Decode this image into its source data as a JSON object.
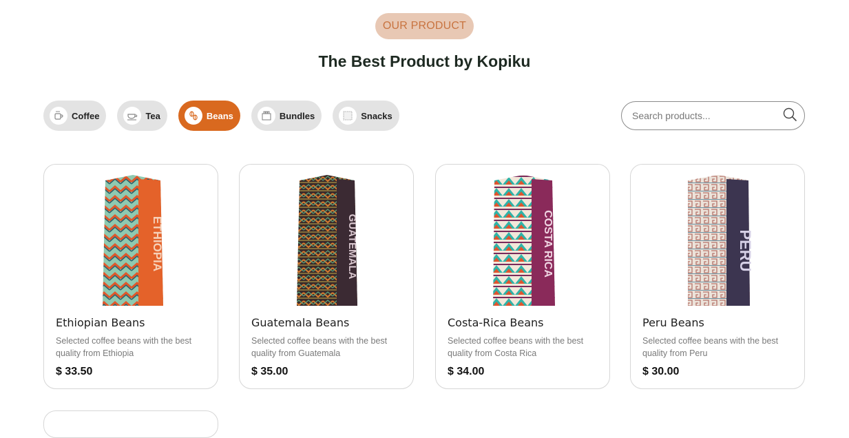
{
  "section": {
    "badge": "OUR PRODUCT",
    "title": "The Best Product by Kopiku"
  },
  "filters": [
    {
      "label": "Coffee",
      "icon": "coffee-cup-icon",
      "active": false
    },
    {
      "label": "Tea",
      "icon": "teacup-icon",
      "active": false
    },
    {
      "label": "Beans",
      "icon": "beans-icon",
      "active": true
    },
    {
      "label": "Bundles",
      "icon": "bundle-box-icon",
      "active": false
    },
    {
      "label": "Snacks",
      "icon": "snack-icon",
      "active": false
    }
  ],
  "search": {
    "placeholder": "Search products...",
    "value": "",
    "icon": "search-icon"
  },
  "products": [
    {
      "name": "Ethiopian Beans",
      "description": "Selected coffee beans with the best quality from Ethiopia",
      "price": "$ 33.50",
      "bag_text": "ETHIOPIA",
      "colors": {
        "pattern": "#3f9c8a",
        "accent": "#e4622a"
      }
    },
    {
      "name": "Guatemala Beans",
      "description": "Selected coffee beans with the best quality from Guatemala",
      "price": "$ 35.00",
      "bag_text": "GUATEMALA",
      "colors": {
        "pattern": "#6a3a2a",
        "accent": "#3b2a33"
      }
    },
    {
      "name": "Costa-Rica Beans",
      "description": "Selected coffee beans with the best quality from Costa Rica",
      "price": "$ 34.00",
      "bag_text": "COSTA RICA",
      "colors": {
        "pattern": "#2fb3a8",
        "accent": "#8a2a5a"
      }
    },
    {
      "name": "Peru Beans",
      "description": "Selected coffee beans with the best quality from Peru",
      "price": "$ 30.00",
      "bag_text": "PERU",
      "colors": {
        "pattern": "#e9ddd3",
        "accent": "#3c3550"
      }
    }
  ],
  "theme": {
    "accent": "#d9691f",
    "badge_bg": "#e8c8b4",
    "badge_text": "#c8733f"
  }
}
